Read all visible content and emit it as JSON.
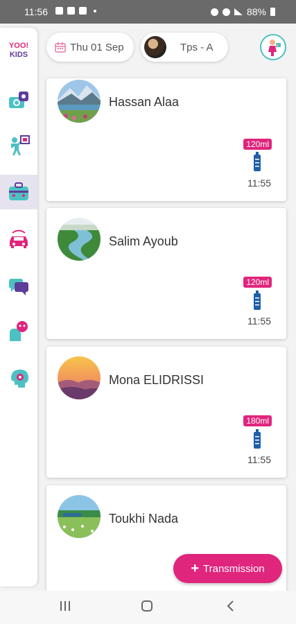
{
  "status_bar": {
    "time": "11:56",
    "battery": "88%"
  },
  "header": {
    "date": "Thu 01 Sep",
    "class_label": "Tps - A"
  },
  "logo": {
    "line1": "YOO!",
    "line2": "KIDS"
  },
  "sidebar": {
    "items": [
      {
        "name": "photos",
        "icon": "camera-icon"
      },
      {
        "name": "activities",
        "icon": "child-board-icon"
      },
      {
        "name": "kit",
        "icon": "bag-icon",
        "active": true
      },
      {
        "name": "transport",
        "icon": "car-icon"
      },
      {
        "name": "messages",
        "icon": "chat-icon"
      },
      {
        "name": "feelings",
        "icon": "hand-heart-icon"
      },
      {
        "name": "development",
        "icon": "brain-icon"
      }
    ]
  },
  "cards": [
    {
      "name": "Hassan Alaa",
      "quantity": "120ml",
      "time": "11:55",
      "avatar": "mountain-lake"
    },
    {
      "name": "Salim Ayoub",
      "quantity": "120ml",
      "time": "11:55",
      "avatar": "river-valley"
    },
    {
      "name": "Mona ELIDRISSI",
      "quantity": "180ml",
      "time": "11:55",
      "avatar": "sunset-hills"
    },
    {
      "name": "Toukhi Nada",
      "quantity": "",
      "time": "",
      "avatar": "meadow"
    }
  ],
  "fab": {
    "label": "Transmission"
  },
  "colors": {
    "accent": "#e0257d",
    "teal": "#4cc1c3",
    "purple": "#5e3c99"
  }
}
